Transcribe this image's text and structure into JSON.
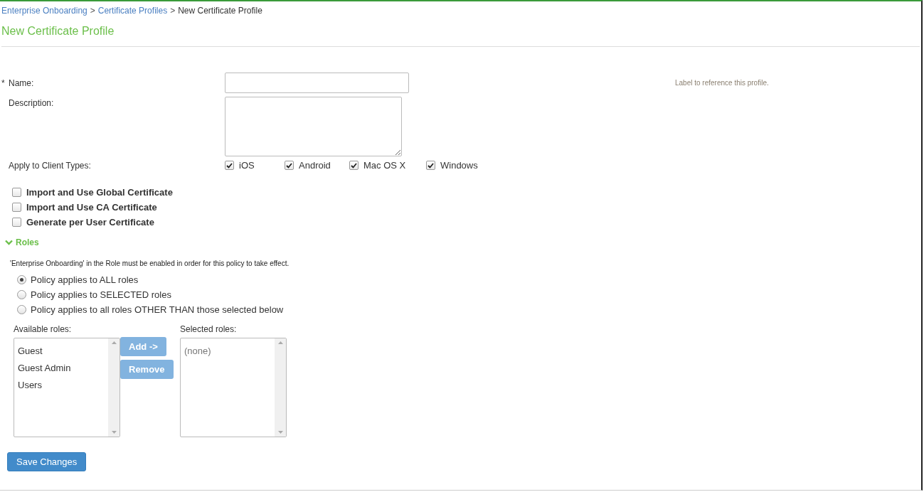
{
  "breadcrumb": [
    {
      "label": "Enterprise Onboarding",
      "link": true
    },
    {
      "label": "Certificate Profiles",
      "link": true
    },
    {
      "label": "New Certificate Profile",
      "link": false
    }
  ],
  "separator": ">",
  "title": "New Certificate Profile",
  "name_field": {
    "required_mark": "*",
    "label": "Name:",
    "hint": "Label to reference this profile."
  },
  "description_field": {
    "label": "Description:"
  },
  "client_types": {
    "label": "Apply to Client Types:",
    "options": [
      {
        "label": "iOS",
        "checked": true
      },
      {
        "label": "Android",
        "checked": true
      },
      {
        "label": "Mac OS X",
        "checked": true
      },
      {
        "label": "Windows",
        "checked": true
      }
    ]
  },
  "certificate_options": [
    {
      "label": "Import and Use Global Certificate",
      "checked": false
    },
    {
      "label": "Import and Use CA Certificate",
      "checked": false
    },
    {
      "label": "Generate per User Certificate",
      "checked": false
    }
  ],
  "roles_section": {
    "title": "Roles",
    "expanded": true,
    "note": "'Enterprise Onboarding' in the Role must be enabled in order for this policy to take effect.",
    "policy_options": [
      {
        "label": "Policy applies to ALL roles",
        "selected": true
      },
      {
        "label": "Policy applies to SELECTED roles",
        "selected": false
      },
      {
        "label": "Policy applies to all roles OTHER THAN those selected below",
        "selected": false
      }
    ],
    "available_label": "Available roles:",
    "available_roles": [
      "Guest",
      "Guest Admin",
      "Users"
    ],
    "add_button": "Add ->",
    "remove_button": "Remove",
    "selected_label": "Selected roles:",
    "selected_roles_placeholder": "(none)"
  },
  "save_button": "Save Changes"
}
